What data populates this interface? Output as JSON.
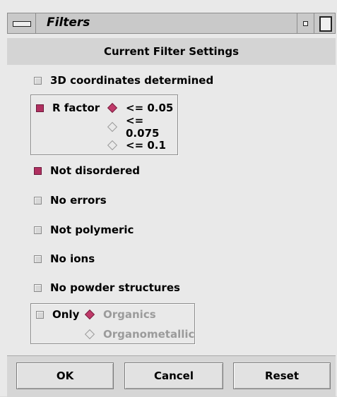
{
  "window": {
    "title": "Filters",
    "header": "Current Filter Settings"
  },
  "filters": {
    "coords_3d": {
      "label": "3D coordinates determined",
      "checked": false
    },
    "r_factor": {
      "label": "R factor",
      "checked": true,
      "options": [
        {
          "label": "<= 0.05",
          "selected": true
        },
        {
          "label": "<= 0.075",
          "selected": false
        },
        {
          "label": "<= 0.1",
          "selected": false
        }
      ]
    },
    "not_disordered": {
      "label": "Not disordered",
      "checked": true
    },
    "no_errors": {
      "label": "No errors",
      "checked": false
    },
    "not_polymeric": {
      "label": "Not polymeric",
      "checked": false
    },
    "no_ions": {
      "label": "No ions",
      "checked": false
    },
    "no_powder": {
      "label": "No powder structures",
      "checked": false
    },
    "only": {
      "label": "Only",
      "checked": false,
      "options": [
        {
          "label": "Organics",
          "selected": true
        },
        {
          "label": "Organometallic",
          "selected": false
        }
      ]
    }
  },
  "buttons": {
    "ok": "OK",
    "cancel": "Cancel",
    "reset": "Reset"
  },
  "colors": {
    "checked": "#b03060",
    "background": "#e9e9e9"
  }
}
